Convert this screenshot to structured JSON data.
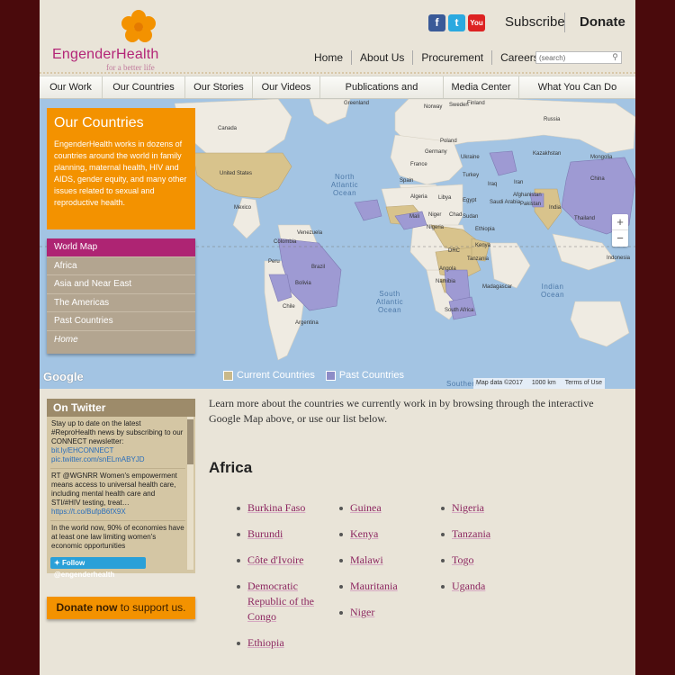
{
  "header": {
    "brand": "EngenderHealth",
    "tagline": "for a better life",
    "social": {
      "facebook": "f",
      "twitter": "t",
      "youtube": "You"
    },
    "subscribe": "Subscribe",
    "donate": "Donate"
  },
  "topnav": [
    "Home",
    "About Us",
    "Procurement",
    "Careers"
  ],
  "search": {
    "value": "(search)"
  },
  "mainnav": [
    "Our Work",
    "Our Countries",
    "Our Stories",
    "Our Videos",
    "Publications and Resources",
    "Media Center",
    "What You Can Do"
  ],
  "map": {
    "labels": [
      "Norway",
      "Sweden",
      "Finland",
      "Russia",
      "Kazakhstan",
      "Mongolia",
      "China",
      "India",
      "Iran",
      "Saudi Arabia",
      "Egypt",
      "Libya",
      "Algeria",
      "Niger",
      "Mali",
      "Chad",
      "Sudan",
      "Nigeria",
      "Ethiopia",
      "Kenya",
      "DRC",
      "Tanzania",
      "Angola",
      "Namibia",
      "South Africa",
      "Madagascar",
      "Turkey",
      "Iraq",
      "Ukraine",
      "Germany",
      "Poland",
      "France",
      "Spain",
      "Canada",
      "United States",
      "Mexico",
      "Venezuela",
      "Colombia",
      "Peru",
      "Brazil",
      "Bolivia",
      "Chile",
      "Argentina",
      "Indonesia",
      "Greenland",
      "Afghanistan",
      "Pakistan",
      "Thailand"
    ],
    "oceans": [
      "North Atlantic Ocean",
      "South Atlantic Ocean",
      "Indian Ocean"
    ],
    "southern": "Southern",
    "zoom": [
      "+",
      "−"
    ],
    "google": "Google",
    "legend": [
      {
        "label": "Current Countries",
        "color": "#c9b98a"
      },
      {
        "label": "Past Countries",
        "color": "#8d8cc7"
      }
    ],
    "attribution": [
      "Map data ©2017",
      "1000 km",
      "Terms of Use"
    ]
  },
  "panel": {
    "title": "Our Countries",
    "body": "EngenderHealth works in dozens of countries around the world in family planning, maternal health, HIV and AIDS, gender equity, and many other issues related to sexual and reproductive health."
  },
  "regions": [
    "World Map",
    "Africa",
    "Asia and Near East",
    "The Americas",
    "Past Countries",
    "Home"
  ],
  "twitter": {
    "title": "On Twitter",
    "tweets": [
      {
        "text": "Stay up to date on the latest #ReproHealth news by subscribing to our CONNECT newsletter:",
        "link": "bit.ly/EHCONNECT pic.twitter.com/snELmABYJD"
      },
      {
        "text": "RT @WGNRR Women's empowerment means access to universal health care, including mental health care and STI/#HIV testing, treat…",
        "link": "https://t.co/BufpB6fX9X"
      },
      {
        "text": "In the world now, 90% of economies have at least one law limiting women's economic opportunities",
        "link": ""
      }
    ],
    "follow": "Follow @engenderhealth"
  },
  "donate_box": {
    "strong": "Donate now",
    "rest": " to support us."
  },
  "intro": "Learn more about the countries we currently work in by browsing through the interactive Google Map above, or use our list below.",
  "africa": {
    "heading": "Africa",
    "col1": [
      "Burkina Faso",
      "Burundi",
      "Côte d'Ivoire",
      "Democratic Republic of the Congo",
      "Ethiopia"
    ],
    "col2": [
      "Guinea",
      "Kenya",
      "Malawi",
      "Mauritania",
      "Niger"
    ],
    "col3": [
      "Nigeria",
      "Tanzania",
      "Togo",
      "Uganda"
    ]
  },
  "colors": {
    "accent_orange": "#f39200",
    "brand_magenta": "#ae2473",
    "current": "#c9b98a",
    "past": "#8d8cc7"
  }
}
